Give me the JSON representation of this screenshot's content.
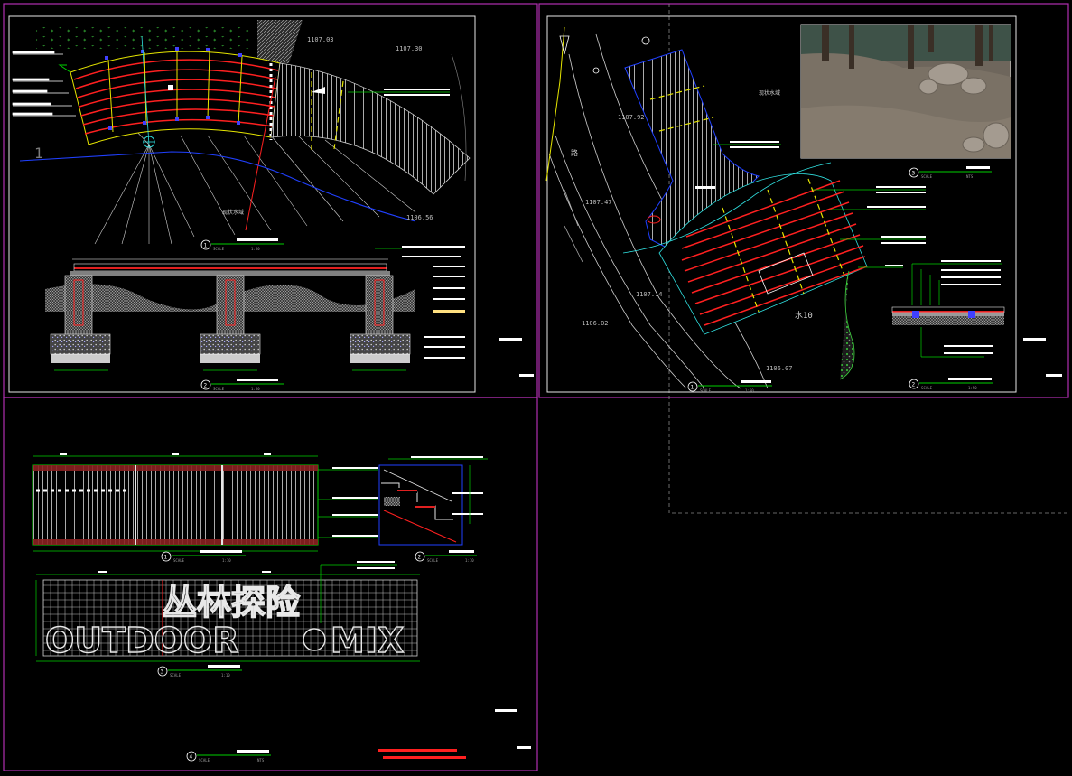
{
  "colors": {
    "background": "#000000",
    "sheet_border": "#b030b0",
    "panel_border": "#ffffff",
    "deck_red": "#ff2020",
    "deck_yellow": "#e6e600",
    "deck_cyan": "#30e0e0",
    "hatch_grey": "#c8c8c8",
    "leader_green": "#00d000",
    "blue_line": "#2040ff",
    "dashed_grey": "#888888"
  },
  "sheet1": {
    "section_number_marker": "1",
    "elevations": [
      "1107.03",
      "1107.30",
      "1106.56"
    ],
    "water_label": "现状水域",
    "drawings": [
      {
        "num": "1",
        "scale_label": "SCALE",
        "scale": "1:50"
      },
      {
        "num": "2",
        "scale_label": "SCALE",
        "scale": "1:50"
      }
    ]
  },
  "sheet2": {
    "elevations": [
      "1107.92",
      "1107.47",
      "1107.14",
      "1106.02",
      "1106.07"
    ],
    "road_label": "路",
    "water_label": "现状水域",
    "area_label": "水10",
    "photo_icon": "photo-rocks",
    "drawings": [
      {
        "num": "1",
        "scale_label": "SCALE",
        "scale": "1:50"
      },
      {
        "num": "2",
        "scale_label": "SCALE",
        "scale": "1:50"
      },
      {
        "num": "3",
        "scale_label": "SCALE",
        "scale": "NTS"
      }
    ]
  },
  "sheet3": {
    "sign_text_cn": "丛林探险",
    "sign_text_en": "OUTDOOR",
    "sign_text_en2": "MIX",
    "drawings": [
      {
        "num": "1",
        "scale_label": "SCALE",
        "scale": "1:10"
      },
      {
        "num": "2",
        "scale_label": "SCALE",
        "scale": "1:10"
      },
      {
        "num": "3",
        "scale_label": "SCALE",
        "scale": "1:10"
      },
      {
        "num": "4",
        "scale_label": "SCALE",
        "scale": "NTS"
      }
    ]
  }
}
